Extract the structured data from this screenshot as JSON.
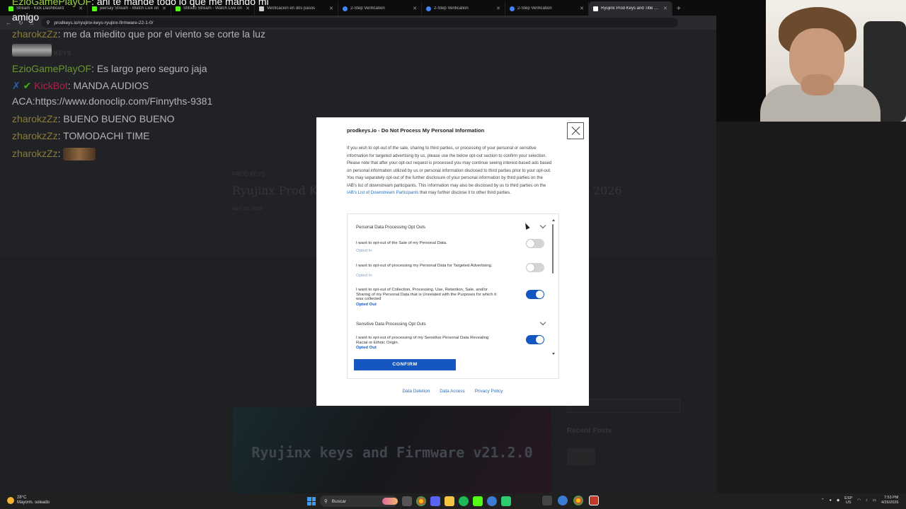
{
  "tabs": [
    {
      "title": "Stream - Kick Dashboard",
      "color": "#53fc18"
    },
    {
      "title": "jeersay Stream - Watch Live on",
      "color": "#53fc18"
    },
    {
      "title": "Sfitodo Stream - Watch Live on",
      "color": "#53fc18"
    },
    {
      "title": "Verificación en dos pasos",
      "color": "#cccccc"
    },
    {
      "title": "2-Step Verification",
      "color": "#4285f4"
    },
    {
      "title": "2-Step Verification",
      "color": "#4285f4"
    },
    {
      "title": "2-Step Verification",
      "color": "#4285f4"
    },
    {
      "title": "Ryujinx Prod Keys and Title Keys",
      "color": "#ffffff",
      "active": true
    }
  ],
  "address": {
    "url": "prodkeys.io/ryujinx-keys-ryujinx-firmware-22-1-0/"
  },
  "background_page": {
    "category_tag": "PROD KEYS",
    "headline_left": "Ryujinx Prod Ke",
    "headline_right": "2026",
    "meta": "April 16, 2026",
    "banner_text": "Ryujinx keys and Firmware v21.2.0",
    "sidebar_heading": "Recent Posts",
    "nav_ghost": "OD KEYS"
  },
  "chat": {
    "messages": [
      {
        "user": "EzioGamePlayOF",
        "text": "ahi te mande todo lo que me mando mi"
      },
      {
        "user": "",
        "text": "amigo"
      },
      {
        "user": "zharokzZz",
        "text": "me da miedito que por el viento se corte la luz"
      },
      {
        "user": "EzioGamePlayOF",
        "text": "Es largo pero seguro jaja"
      },
      {
        "user": "KickBot",
        "text": "MANDA AUDIOS"
      },
      {
        "user": "",
        "text": "ACA:https://www.donoclip.com/Finnyths-9381"
      },
      {
        "user": "zharokzZz",
        "text": "BUENO BUENO BUENO"
      },
      {
        "user": "zharokzZz",
        "text": "TOMODACHI TIME"
      },
      {
        "user": "zharokzZz",
        "text": ""
      }
    ]
  },
  "modal": {
    "title": "prodkeys.io - Do Not Process My Personal Information",
    "intro": "If you wish to opt-out of the sale, sharing to third parties, or processing of your personal or sensitive information for targeted advertising by us, please use the below opt-out section to confirm your selection. Please note that after your opt-out request is processed you may continue seeing interest-based ads based on personal information utilized by us or personal information disclosed to third parties prior to your opt-out. You may separately opt-out of the further disclosure of your personal information by third parties on the IAB's list of downstream participants. This information may also be disclosed by us to third parties on the",
    "intro_link": "IAB's List of Downstream Participants",
    "intro_tail": "that may further disclose it to other third parties.",
    "section1": "Personal Data Processing Opt Outs",
    "section2": "Sensitive Data Processing Opt Outs",
    "options": [
      {
        "label": "I want to opt-out of the Sale of my Personal Data.",
        "status": "Opted In",
        "on": false
      },
      {
        "label": "I want to opt-out of processing my Personal Data for Targeted Advertising.",
        "status": "Opted In",
        "on": false
      },
      {
        "label": "I want to opt-out of Collection, Processing, Use, Retention, Sale, and/or Sharing of my Personal Data that is Unrelated with the Purposes for which it was collected",
        "status": "Opted Out",
        "on": true
      },
      {
        "label": "I want to opt-out of processing of my Sensitive Personal Data Revealing Racial or Ethnic Origin.",
        "status": "Opted Out",
        "on": true
      }
    ],
    "confirm": "CONFIRM",
    "links": [
      "Data Deletion",
      "Data Access",
      "Privacy Policy"
    ]
  },
  "taskbar": {
    "weather_temp": "28°C",
    "weather_desc": "Mayorm. soleado",
    "search": "Buscar",
    "lang_top": "ESP",
    "lang_bottom": "US",
    "time": "7:53 PM",
    "date": "4/26/2026"
  }
}
